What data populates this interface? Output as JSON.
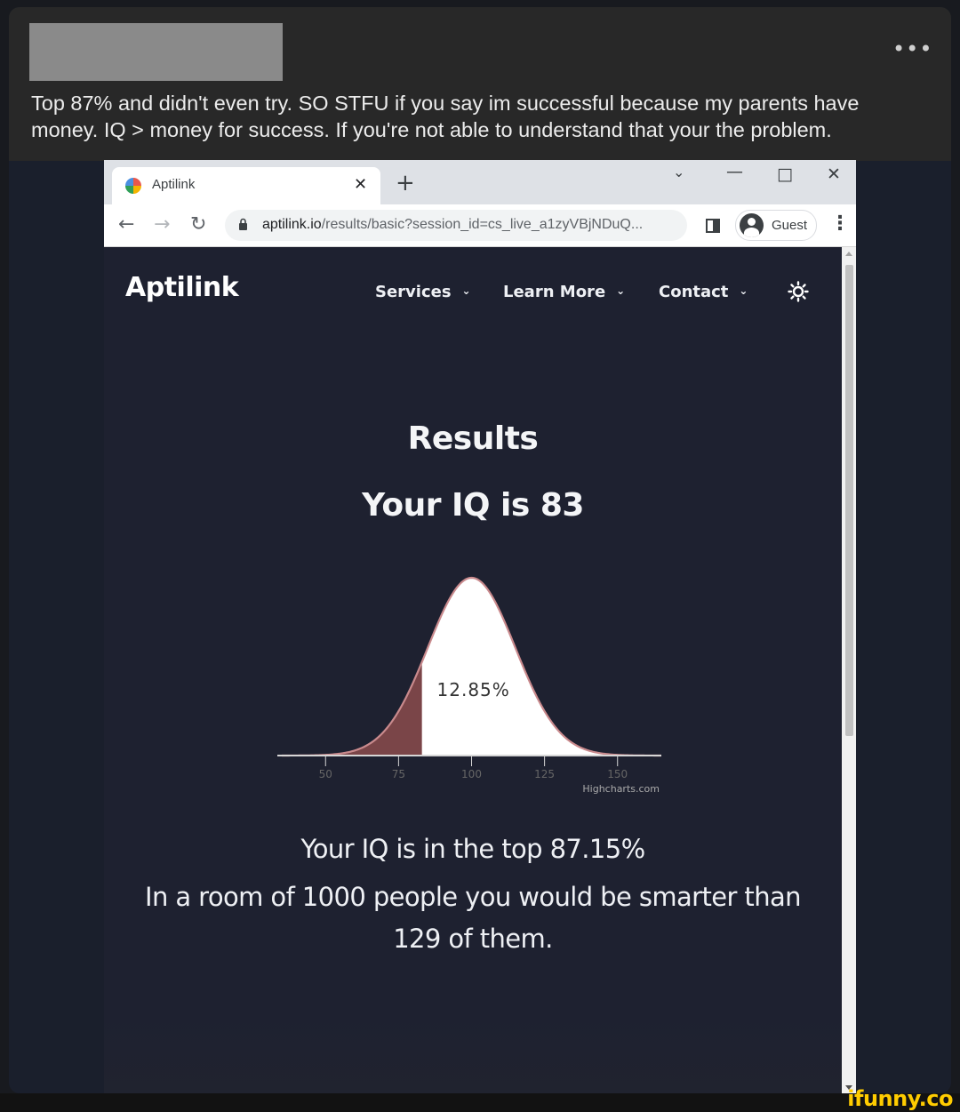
{
  "post": {
    "caption": "Top 87% and didn't even try. SO STFU if you say im successful because my parents have money. IQ > money for success. If you're not able to understand that your the problem.",
    "more_icon": "more-horizontal-icon"
  },
  "watermark": "ifunny.co",
  "browser": {
    "tab_title": "Aptilink",
    "close_glyph": "✕",
    "new_tab_glyph": "+",
    "url_host": "aptilink.io",
    "url_path": "/results/basic?session_id=cs_live_a1zyVBjNDuQ...",
    "profile_label": "Guest"
  },
  "site": {
    "brand": "Aptilink",
    "nav": [
      {
        "label": "Services"
      },
      {
        "label": "Learn More"
      },
      {
        "label": "Contact"
      }
    ],
    "theme_icon": "sun-icon"
  },
  "results": {
    "title": "Results",
    "iq_heading": "Your IQ is 83",
    "percentile_text": "Your IQ is in the top 87.15%",
    "comparison_text": "In a room of 1000 people you would be smarter than 129 of them."
  },
  "chart_data": {
    "type": "area",
    "distribution": "normal",
    "mean": 100,
    "sd": 15,
    "x_range": [
      35,
      165
    ],
    "x_ticks": [
      50,
      75,
      100,
      125,
      150
    ],
    "highlight_upto": 83,
    "highlight_label": "12.85%",
    "credits": "Highcharts.com",
    "colors": {
      "line": "#c98a8d",
      "shaded": "#7a4548",
      "fill": "#ffffff",
      "axis": "#d6d6d6",
      "tick_label": "#666666"
    }
  }
}
